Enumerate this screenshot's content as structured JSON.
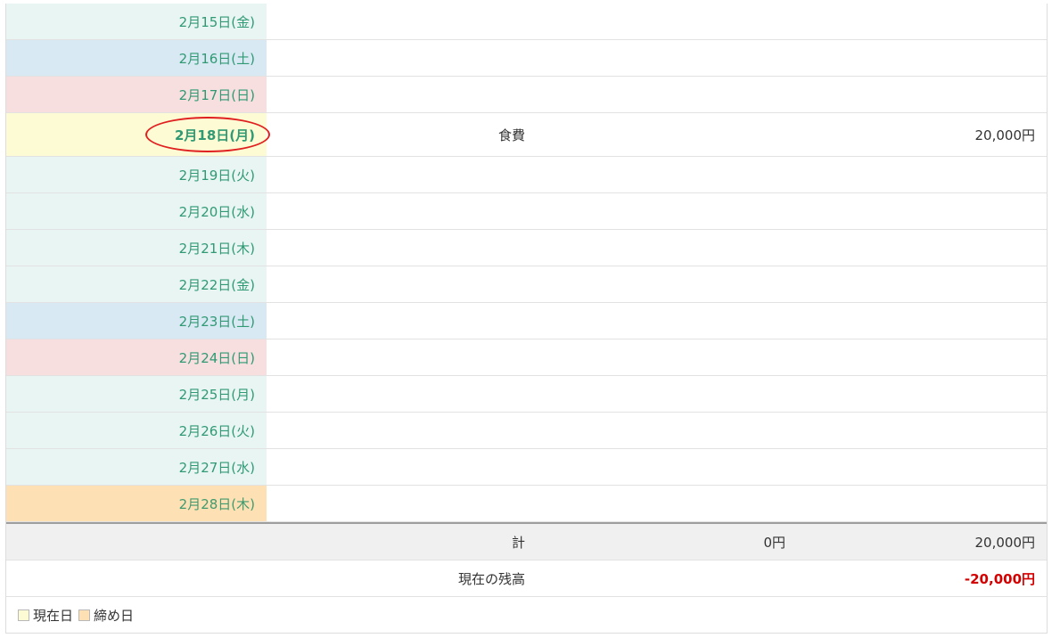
{
  "days": [
    {
      "date": "2月15日(金)",
      "type": "weekday"
    },
    {
      "date": "2月16日(土)",
      "type": "sat"
    },
    {
      "date": "2月17日(日)",
      "type": "sun"
    },
    {
      "date": "2月18日(月)",
      "type": "today",
      "category": "食費",
      "expense": "20,000円"
    },
    {
      "date": "2月19日(火)",
      "type": "weekday"
    },
    {
      "date": "2月20日(水)",
      "type": "weekday"
    },
    {
      "date": "2月21日(木)",
      "type": "weekday"
    },
    {
      "date": "2月22日(金)",
      "type": "weekday"
    },
    {
      "date": "2月23日(土)",
      "type": "sat"
    },
    {
      "date": "2月24日(日)",
      "type": "sun"
    },
    {
      "date": "2月25日(月)",
      "type": "weekday"
    },
    {
      "date": "2月26日(火)",
      "type": "weekday"
    },
    {
      "date": "2月27日(水)",
      "type": "weekday"
    },
    {
      "date": "2月28日(木)",
      "type": "closing"
    }
  ],
  "total": {
    "label": "計",
    "income": "0円",
    "expense": "20,000円"
  },
  "balance": {
    "label": "現在の残高",
    "value": "-20,000円"
  },
  "legend": {
    "today": "現在日",
    "closing": "締め日"
  },
  "colors": {
    "today_swatch": "#fdfbd3",
    "closing_swatch": "#fde1b4",
    "highlight_circle": "#e02020",
    "negative": "#d40000"
  }
}
